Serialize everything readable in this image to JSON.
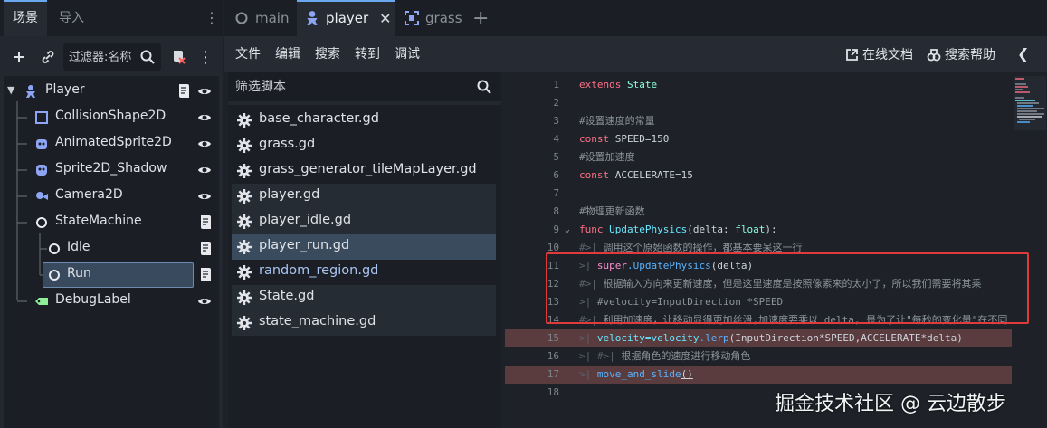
{
  "scene_dock": {
    "tabs": [
      {
        "label": "场景"
      },
      {
        "label": "导入"
      }
    ],
    "filter_placeholder": "过滤器:名称",
    "tree": [
      {
        "label": "Player",
        "icon": "character-body-icon",
        "script": true,
        "visible": true
      },
      {
        "label": "CollisionShape2D",
        "icon": "collision-shape-icon",
        "script": false,
        "visible": true
      },
      {
        "label": "AnimatedSprite2D",
        "icon": "animated-sprite-icon",
        "script": false,
        "visible": true
      },
      {
        "label": "Sprite2D_Shadow",
        "icon": "sprite-icon",
        "script": false,
        "visible": true
      },
      {
        "label": "Camera2D",
        "icon": "camera-icon",
        "script": false,
        "visible": true
      },
      {
        "label": "StateMachine",
        "icon": "node-icon",
        "script": true,
        "visible": false
      },
      {
        "label": "Idle",
        "icon": "node-icon",
        "script": true,
        "visible": false
      },
      {
        "label": "Run",
        "icon": "node-icon",
        "script": true,
        "visible": false
      },
      {
        "label": "DebugLabel",
        "icon": "label-icon",
        "script": false,
        "visible": true
      }
    ]
  },
  "editor_tabs": [
    {
      "label": "main"
    },
    {
      "label": "player"
    },
    {
      "label": "grass"
    }
  ],
  "menu": {
    "file": "文件",
    "edit": "编辑",
    "search": "搜索",
    "goto": "转到",
    "debug": "调试",
    "online_docs": "在线文档",
    "search_help": "搜索帮助"
  },
  "script_panel": {
    "filter_placeholder": "筛选脚本",
    "scripts": [
      {
        "name": "base_character.gd"
      },
      {
        "name": "grass.gd"
      },
      {
        "name": "grass_generator_tileMapLayer.gd"
      },
      {
        "name": "player.gd"
      },
      {
        "name": "player_idle.gd"
      },
      {
        "name": "player_run.gd"
      },
      {
        "name": "random_region.gd"
      },
      {
        "name": "State.gd"
      },
      {
        "name": "state_machine.gd"
      }
    ]
  },
  "code": {
    "line_numbers": [
      "1",
      "2",
      "3",
      "4",
      "5",
      "6",
      "7",
      "8",
      "9",
      "10",
      "11",
      "12",
      "13",
      "14",
      "15",
      "16",
      "17",
      "18"
    ],
    "l1_kw": "extends",
    "l1_ty": "State",
    "l3": "#设置速度的常量",
    "l4_kw": "const",
    "l4_rest": "SPEED=150",
    "l5": "#设置加速度",
    "l6_kw": "const",
    "l6_rest": "ACCELERATE=15",
    "l8": "#物理更新函数",
    "l9_kw": "func",
    "l9_fn": "UpdatePhysics",
    "l9_open": "(delta: ",
    "l9_ty": "float",
    "l9_close": "):",
    "l10": "调用这个原始函数的操作，都基本要呆这一行",
    "l11_kw": "super",
    "l11_fn": ".UpdatePhysics",
    "l11_rest": "(delta)",
    "l12": "根据输入方向来更新速度，但是这里速度是按照像素来的太小了，所以我们需要将其乘",
    "l13": "#velocity=InputDirection *SPEED",
    "l14": "利用加速度，让移动显得更加丝滑,加速度要乘以 delta, 是为了让\"每秒的变化量\"在不同",
    "l15_a": "velocity=velocity",
    "l15_fn": ".lerp",
    "l15_rest": "(InputDirection*SPEED,ACCELERATE*delta)",
    "l16": "根据角色的速度进行移动角色",
    "l17_fn": "move_and_slide",
    "l17_rest": "()"
  },
  "watermark": "掘金技术社区 @ 云边散步"
}
